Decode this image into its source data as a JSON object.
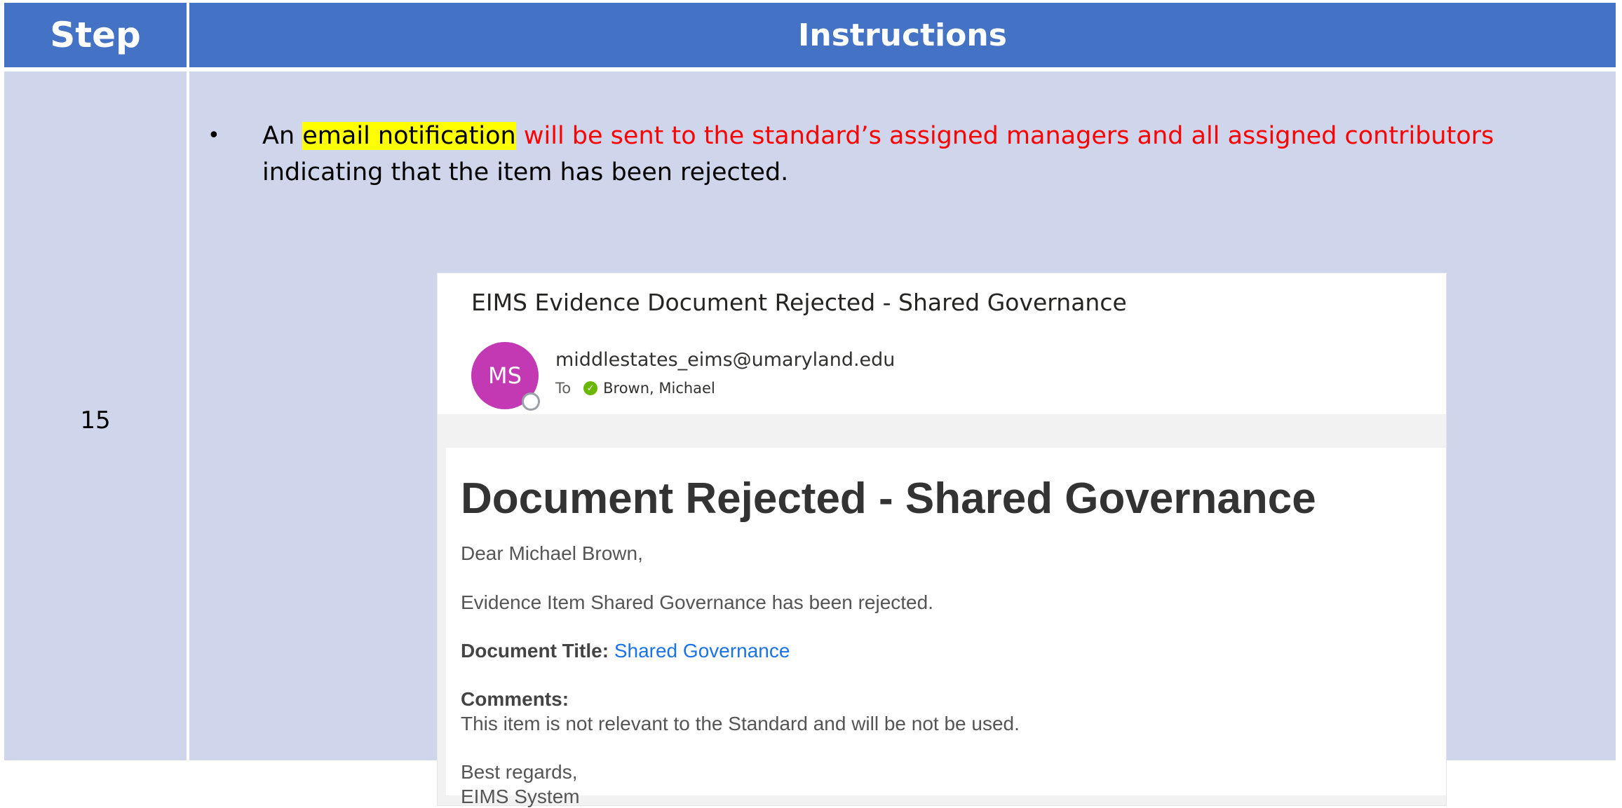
{
  "table": {
    "header_step": "Step",
    "header_instructions": "Instructions",
    "step_number": "15"
  },
  "bullet": {
    "symbol": "•",
    "part1": "An ",
    "highlight": "email notification",
    "red_text": " will be sent to the standard’s assigned managers and all assigned contributors",
    "part2": " indicating that the item has been rejected."
  },
  "email": {
    "subject": "EIMS Evidence Document Rejected - Shared  Governance",
    "avatar_initials": "MS",
    "sender": "middlestates_eims@umaryland.edu",
    "to_label": "To",
    "recipient": "Brown, Michael",
    "title": "Document Rejected - Shared Governance",
    "greeting": "Dear Michael Brown,",
    "message": "Evidence Item Shared Governance has been rejected.",
    "doc_title_label": "Document Title:",
    "doc_title_value": "Shared Governance",
    "comments_label": "Comments:",
    "comments_text": "This item is not relevant to the Standard and will be not be used.",
    "sign_off": "Best regards,",
    "signature": "EIMS System"
  },
  "colors": {
    "header_bg": "#4472C4",
    "cell_bg": "#CFD5EA",
    "highlight": "#FFFF00",
    "red_text": "#FF0000",
    "avatar": "#C239B3",
    "link": "#1a73e8"
  },
  "icons": {
    "presence": "presence-status-icon",
    "recipient_status": "check-circle-icon"
  }
}
